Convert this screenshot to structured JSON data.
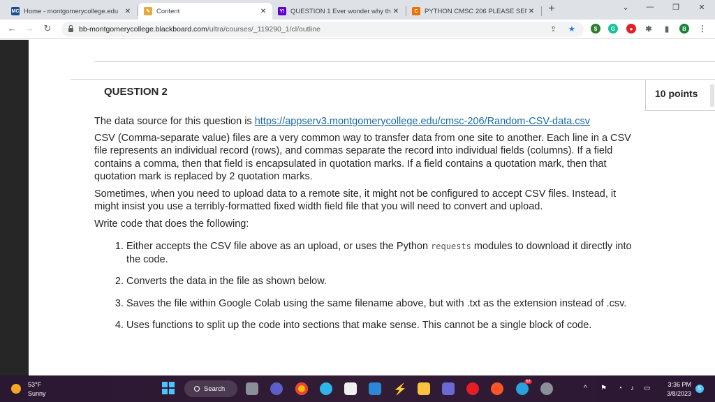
{
  "tabs": [
    {
      "title": "Home - montgomerycollege.edu",
      "icon": "mc-icon",
      "icon_text": "MC",
      "color": "#1b4c8c"
    },
    {
      "title": "Content",
      "icon": "blackboard-icon",
      "icon_text": "",
      "color": "#e8a83b"
    },
    {
      "title": "QUESTION 1 Ever wonder why th",
      "icon": "yahoo-icon",
      "icon_text": "Y!",
      "color": "#6001d2"
    },
    {
      "title": "PYTHON CMSC 206 PLEASE SEN",
      "icon": "chegg-icon",
      "icon_text": "C",
      "color": "#eb7100"
    }
  ],
  "address": {
    "domain": "bb-montgomerycollege.blackboard.com",
    "path": "/ultra/courses/_119290_1/cl/outline"
  },
  "profile_letter": "B",
  "question": {
    "title": "QUESTION 2",
    "points": "10 points",
    "source_prefix": "The data source for this question is ",
    "source_link": "https://appserv3.montgomerycollege.edu/cmsc-206/Random-CSV-data.csv",
    "para1": "CSV (Comma-separate value) files are a very common way to transfer data from one site to another.  Each line in a CSV file represents an individual record (rows), and commas separate the record into individual fields (columns).  If a field contains a comma, then that field is encapsulated in quotation marks.  If a field contains a quotation mark, then that quotation mark is replaced by 2 quotation marks.",
    "para2": "Sometimes, when you need to upload data to a remote site, it might not be configured to accept CSV files.  Instead, it might insist you use a terribly-formatted fixed width field file that you will need to convert and upload.",
    "para3": "Write code that does the following:",
    "items": [
      {
        "before": "Either accepts the CSV file above as an upload, or uses the Python ",
        "code": "requests",
        "after": " modules to download it directly into the code."
      },
      {
        "text": "Converts the data in the file as shown below."
      },
      {
        "text": "Saves the file within Google Colab using the same filename above, but with .txt as the extension instead of .csv."
      },
      {
        "text": "Uses functions to split up the code into sections that make sense.  This cannot be a single block of code."
      }
    ]
  },
  "taskbar": {
    "temp": "53°F",
    "condition": "Sunny",
    "search_label": "Search",
    "time": "3:36 PM",
    "date": "3/8/2023",
    "notification_count": "5",
    "badge_count": "68"
  }
}
